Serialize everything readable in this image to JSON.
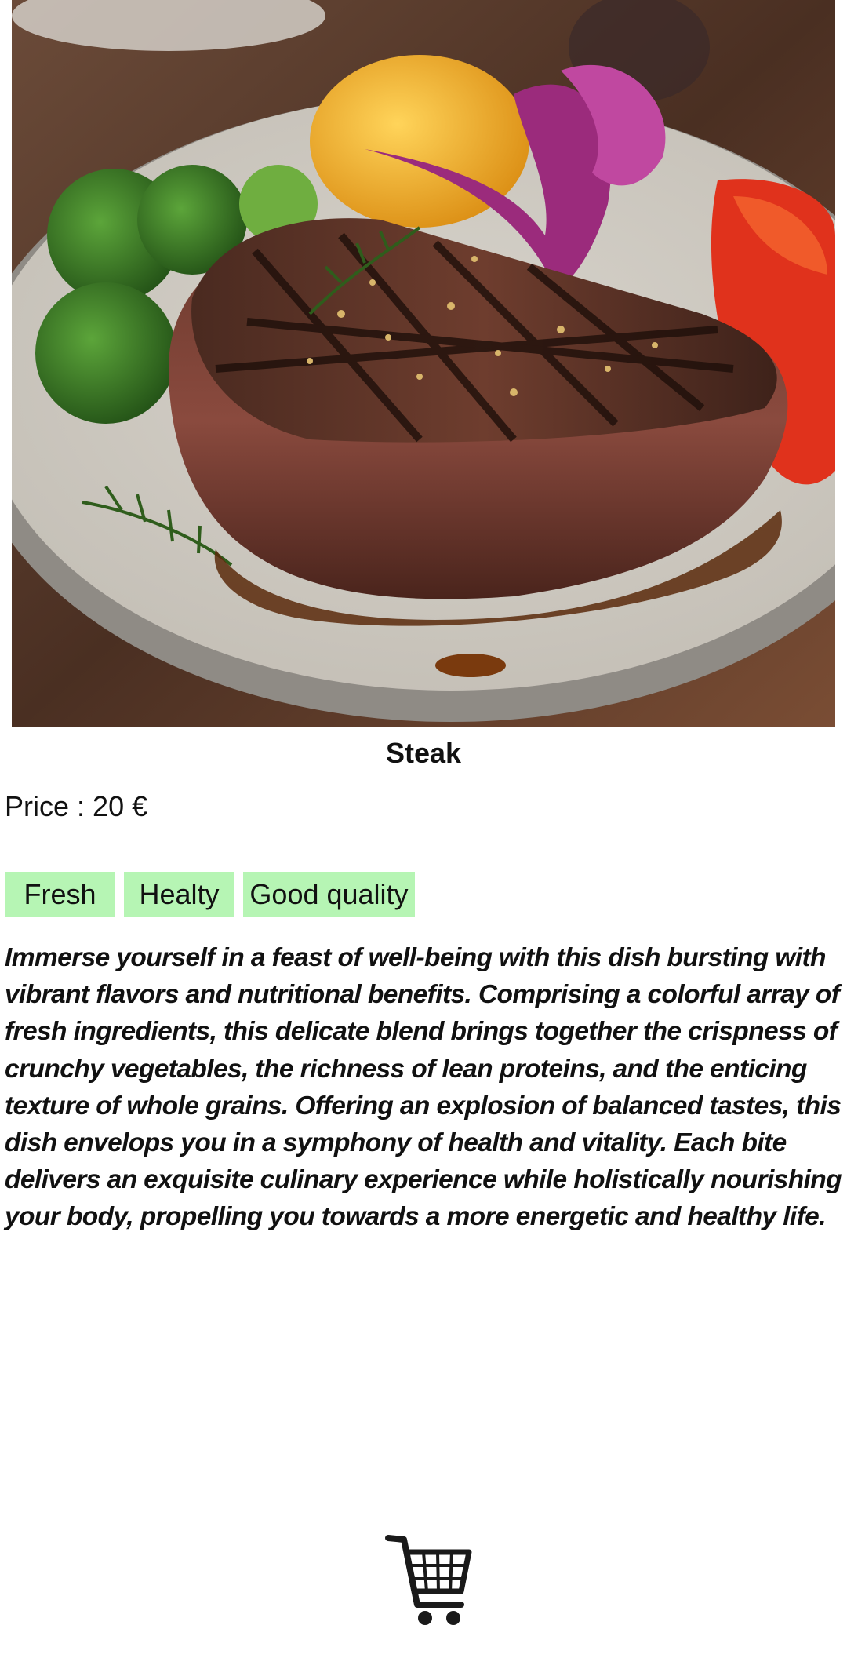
{
  "product": {
    "name": "Steak",
    "price_label": "Price :",
    "price_value": "20 €",
    "image_icon": "steak-photo",
    "tags": [
      "Fresh",
      "Healty",
      "Good quality"
    ],
    "description": "Immerse yourself in a feast of well-being with this dish bursting with vibrant flavors and nutritional benefits. Comprising a colorful array of fresh ingredients, this delicate blend brings together the crispness of crunchy vegetables, the richness of lean proteins, and the enticing texture of whole grains. Offering an explosion of balanced tastes, this dish envelops you in a symphony of health and vitality. Each bite delivers an exquisite culinary experience while holistically nourishing your body, propelling you towards a more energetic and healthy life."
  },
  "actions": {
    "cart_icon": "shopping-cart-icon"
  },
  "colors": {
    "tag_background": "#b6f5b4",
    "text": "#111111",
    "background": "#ffffff"
  }
}
